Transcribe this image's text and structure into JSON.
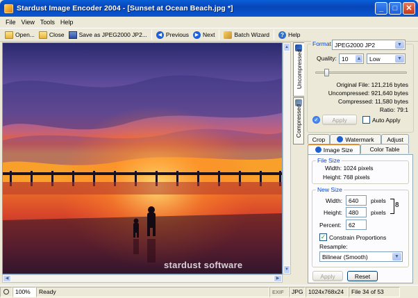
{
  "window": {
    "title": "Stardust Image Encoder 2004 - [Sunset at Ocean Beach.jpg *]"
  },
  "menu": [
    "File",
    "View",
    "Tools",
    "Help"
  ],
  "toolbar": {
    "open": "Open...",
    "close": "Close",
    "save_as": "Save as JPEG2000 JP2...",
    "previous": "Previous",
    "next": "Next",
    "batch": "Batch Wizard",
    "help": "Help"
  },
  "image": {
    "watermark": "stardust software"
  },
  "view_tabs": {
    "uncompressed": "Uncompressed",
    "compressed": "Compressed"
  },
  "format": {
    "label": "Format",
    "value": "JPEG2000 JP2"
  },
  "quality": {
    "label": "Quality:",
    "value": "10",
    "level": "Low",
    "slider_fraction": 0.1
  },
  "stats": {
    "original": "Original File: 121,216 bytes",
    "uncompressed": "Uncompressed: 921,640 bytes",
    "compressed": "Compressed: 11,580 bytes",
    "ratio": "Ratio: 79:1"
  },
  "apply_top": "Apply",
  "auto_apply": "Auto Apply",
  "tabs": {
    "crop": "Crop",
    "watermark": "Watermark",
    "adjust": "Adjust",
    "image_size": "Image Size",
    "color_table": "Color Table"
  },
  "file_size": {
    "legend": "File Size",
    "width": "Width: 1024 pixels",
    "height": "Height: 768 pixels"
  },
  "new_size": {
    "legend": "New Size",
    "width_label": "Width:",
    "width_value": "640",
    "height_label": "Height:",
    "height_value": "480",
    "unit": "pixels",
    "percent_label": "Percent:",
    "percent_value": "62",
    "constrain": "Constrain Proportions",
    "resample_label": "Resample:",
    "resample_value": "Bilinear (Smooth)"
  },
  "buttons": {
    "apply": "Apply",
    "reset": "Reset"
  },
  "status": {
    "zoom": "100%",
    "state": "Ready",
    "exif": "EXIF",
    "format": "JPG",
    "dimensions": "1024x768x24",
    "file_index": "File 34 of 53"
  },
  "colors": {
    "titlebar": "#0a5fd8",
    "accent": "#0046d5",
    "face": "#ece9d8"
  }
}
